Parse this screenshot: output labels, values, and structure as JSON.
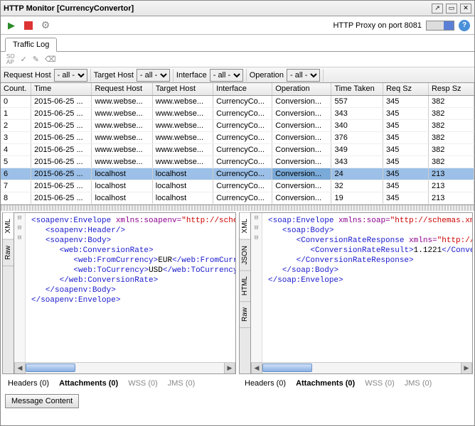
{
  "window": {
    "title": "HTTP Monitor [CurrencyConvertor]"
  },
  "proxy": {
    "label": "HTTP Proxy on port 8081"
  },
  "tabs": {
    "traffic_log": "Traffic Log"
  },
  "filters": {
    "request_host": {
      "label": "Request Host",
      "value": "- all -"
    },
    "target_host": {
      "label": "Target Host",
      "value": "- all -"
    },
    "interface": {
      "label": "Interface",
      "value": "- all -"
    },
    "operation": {
      "label": "Operation",
      "value": "- all -"
    }
  },
  "columns": [
    "Count.",
    "Time",
    "Request Host",
    "Target Host",
    "Interface",
    "Operation",
    "Time Taken",
    "Req Sz",
    "Resp Sz"
  ],
  "rows": [
    {
      "count": "0",
      "time": "2015-06-25 ...",
      "rh": "www.webse...",
      "th": "www.webse...",
      "iface": "CurrencyCo...",
      "op": "Conversion...",
      "tt": "557",
      "req": "345",
      "resp": "382"
    },
    {
      "count": "1",
      "time": "2015-06-25 ...",
      "rh": "www.webse...",
      "th": "www.webse...",
      "iface": "CurrencyCo...",
      "op": "Conversion...",
      "tt": "343",
      "req": "345",
      "resp": "382"
    },
    {
      "count": "2",
      "time": "2015-06-25 ...",
      "rh": "www.webse...",
      "th": "www.webse...",
      "iface": "CurrencyCo...",
      "op": "Conversion...",
      "tt": "340",
      "req": "345",
      "resp": "382"
    },
    {
      "count": "3",
      "time": "2015-06-25 ...",
      "rh": "www.webse...",
      "th": "www.webse...",
      "iface": "CurrencyCo...",
      "op": "Conversion...",
      "tt": "376",
      "req": "345",
      "resp": "382"
    },
    {
      "count": "4",
      "time": "2015-06-25 ...",
      "rh": "www.webse...",
      "th": "www.webse...",
      "iface": "CurrencyCo...",
      "op": "Conversion...",
      "tt": "349",
      "req": "345",
      "resp": "382"
    },
    {
      "count": "5",
      "time": "2015-06-25 ...",
      "rh": "www.webse...",
      "th": "www.webse...",
      "iface": "CurrencyCo...",
      "op": "Conversion...",
      "tt": "343",
      "req": "345",
      "resp": "382"
    },
    {
      "count": "6",
      "time": "2015-06-25 ...",
      "rh": "localhost",
      "th": "localhost",
      "iface": "CurrencyCo...",
      "op": "Conversion...",
      "tt": "24",
      "req": "345",
      "resp": "213",
      "selected": true
    },
    {
      "count": "7",
      "time": "2015-06-25 ...",
      "rh": "localhost",
      "th": "localhost",
      "iface": "CurrencyCo...",
      "op": "Conversion...",
      "tt": "32",
      "req": "345",
      "resp": "213"
    },
    {
      "count": "8",
      "time": "2015-06-25 ...",
      "rh": "localhost",
      "th": "localhost",
      "iface": "CurrencyCo...",
      "op": "Conversion...",
      "tt": "19",
      "req": "345",
      "resp": "213"
    }
  ],
  "left_panel": {
    "tabs": [
      "XML",
      "Raw"
    ],
    "xml": {
      "envelope_open": "soapenv:Envelope",
      "xmlns_attr": "xmlns:soapenv",
      "xmlns_val": "\"http://schemas.xmlsoa",
      "header": "soapenv:Header",
      "body_open": "soapenv:Body",
      "conv_open": "web:ConversionRate",
      "from_open": "web:FromCurrency",
      "from_val": "EUR",
      "from_close": "web:FromCurrency",
      "to_open": "web:ToCurrency",
      "to_val": "USD",
      "to_close": "web:ToCurrency",
      "conv_close": "web:ConversionRate",
      "body_close": "soapenv:Body",
      "envelope_close": "soapenv:Envelope"
    }
  },
  "right_panel": {
    "tabs": [
      "XML",
      "JSON",
      "HTML",
      "Raw"
    ],
    "xml": {
      "envelope_open": "soap:Envelope",
      "xmlns_attr": "xmlns:soap",
      "xmlns_val": "\"http://schemas.xmlsc",
      "body_open": "soap:Body",
      "resp_open": "ConversionRateResponse",
      "resp_xmlns_attr": "xmlns",
      "resp_xmlns_val": "\"http://ww",
      "result_open": "ConversionRateResult",
      "result_val": "1.1221",
      "result_close": "Conversion",
      "resp_close": "ConversionRateResponse",
      "body_close": "soap:Body",
      "envelope_close": "soap:Envelope"
    }
  },
  "bottom_tabs": {
    "headers": "Headers (0)",
    "attachments": "Attachments (0)",
    "wss": "WSS (0)",
    "jms": "JMS (0)"
  },
  "message_content": "Message Content"
}
